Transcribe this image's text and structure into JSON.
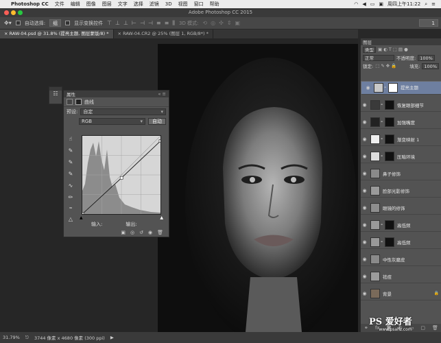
{
  "menubar": {
    "app_name": "Photoshop CC",
    "items": [
      "文件",
      "编辑",
      "图像",
      "图层",
      "文字",
      "选择",
      "滤镜",
      "3D",
      "视图",
      "窗口",
      "帮助"
    ],
    "clock": "周四上午11:22"
  },
  "window": {
    "title": "Adobe Photoshop CC 2015"
  },
  "options": {
    "auto_select_label": "自动选择:",
    "auto_select_value": "组",
    "show_transform_label": "显示变换控件",
    "mode_3d_label": "3D 模式:",
    "right_value": "1"
  },
  "tabs": [
    {
      "label": "RAW-04.psd @ 31.8% (提亮主题, 图层蒙版/8) *"
    },
    {
      "label": "RAW-04.CR2 @ 25% (图层 1, RGB/8*) *"
    }
  ],
  "properties": {
    "panel_title": "属性",
    "adjustment": "曲线",
    "preset_label": "预设:",
    "preset_value": "自定",
    "channel_value": "RGB",
    "auto_button": "自动",
    "input_label": "输入:",
    "output_label": "输出:"
  },
  "curve": {
    "points": [
      [
        0,
        0
      ],
      [
        128,
        118
      ],
      [
        255,
        238
      ]
    ]
  },
  "layers_panel": {
    "title": "图层",
    "kind_label": "类型",
    "blend_mode": "正常",
    "opacity_label": "不透明度:",
    "opacity_value": "100%",
    "lock_label": "锁定:",
    "fill_label": "填充:",
    "fill_value": "100%",
    "layers": [
      {
        "name": "提亮主题",
        "selected": true
      },
      {
        "name": "恢复眼部细节",
        "selected": false
      },
      {
        "name": "加强嘴度",
        "selected": false
      },
      {
        "name": "渐变映射 1",
        "selected": false
      },
      {
        "name": "压暗环境",
        "selected": false
      },
      {
        "name": "鼻子修饰",
        "selected": false
      },
      {
        "name": "脸部光影修饰",
        "selected": false
      },
      {
        "name": "眼镜的修饰",
        "selected": false
      },
      {
        "name": "高低频",
        "selected": false
      },
      {
        "name": "高低频",
        "selected": false
      },
      {
        "name": "中性灰磨皮",
        "selected": false
      },
      {
        "name": "祛痘",
        "selected": false
      },
      {
        "name": "背景",
        "selected": false
      }
    ]
  },
  "status": {
    "zoom": "31.79%",
    "doc_info": "3744 像素 x 4680 像素 (300 ppi)"
  },
  "watermark": {
    "main": "PS 爱好者",
    "sub": "www.psahz.com"
  }
}
